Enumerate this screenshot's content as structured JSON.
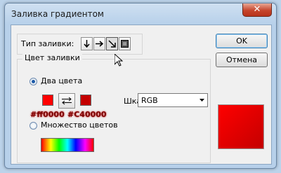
{
  "window": {
    "title": "Заливка градиентом",
    "close_glyph": "✕"
  },
  "fill_type": {
    "label": "Тип заливки:",
    "buttons": [
      {
        "icon": "arrow-down-icon",
        "pressed": false
      },
      {
        "icon": "arrow-right-icon",
        "pressed": false
      },
      {
        "icon": "arrow-diagonal-icon",
        "pressed": true
      },
      {
        "icon": "square-radial-icon",
        "pressed": false
      }
    ]
  },
  "fill_color": {
    "group_label": "Цвет заливки",
    "two_colors_label": "Два цвета",
    "two_colors_checked": true,
    "color1": "#ff0000",
    "color2": "#c40000",
    "color1_code": "#ff0000",
    "color2_code": "#C40000",
    "scale_label": "Шкала:",
    "scale_value": "RGB",
    "many_colors_label": "Множество цветов",
    "many_colors_checked": false
  },
  "buttons": {
    "ok": "OK",
    "cancel": "Отмена"
  },
  "preview": {
    "color_start": "#ff0000",
    "color_end": "#c40000"
  }
}
